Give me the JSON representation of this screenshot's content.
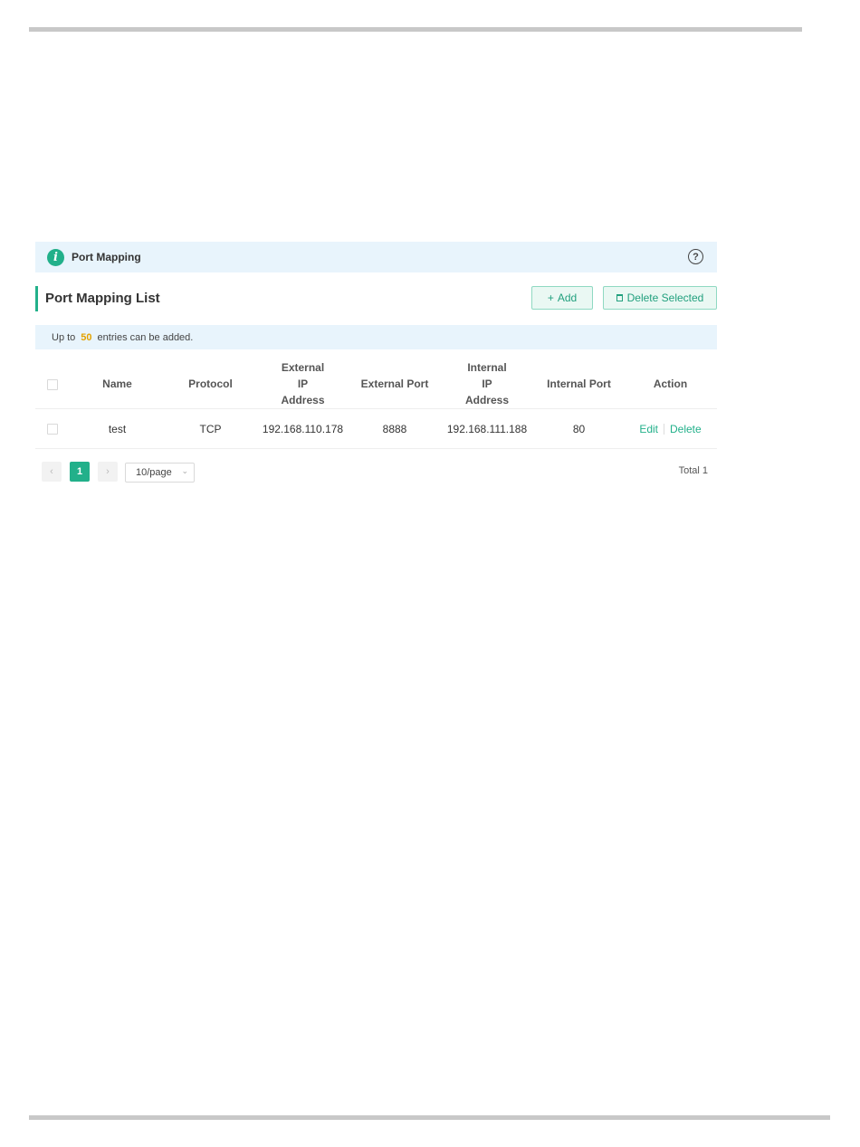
{
  "banner": {
    "title": "Port Mapping",
    "info_icon": "i",
    "help_icon": "?"
  },
  "section": {
    "title": "Port Mapping List"
  },
  "toolbar": {
    "add_label": "Add",
    "add_icon": "+",
    "delete_label": "Delete Selected"
  },
  "note": {
    "prefix": "Up to",
    "count": "50",
    "suffix": "entries can be added."
  },
  "table": {
    "headers": {
      "name": "Name",
      "protocol": "Protocol",
      "external_ip": "External IP Address",
      "external_port": "External Port",
      "internal_ip": "Internal IP Address",
      "internal_port": "Internal Port",
      "action": "Action"
    },
    "rows": [
      {
        "name": "test",
        "protocol": "TCP",
        "external_ip": "192.168.110.178",
        "external_port": "8888",
        "internal_ip": "192.168.111.188",
        "internal_port": "80",
        "edit_label": "Edit",
        "delete_label": "Delete"
      }
    ]
  },
  "pagination": {
    "prev": "‹",
    "current_page": "1",
    "next": "›",
    "page_size": "10/page",
    "chevron": "⌄",
    "total_label": "Total 1"
  },
  "colors": {
    "accent": "#22b08a",
    "banner_bg": "#e8f4fc",
    "count_highlight": "#e3a200"
  }
}
